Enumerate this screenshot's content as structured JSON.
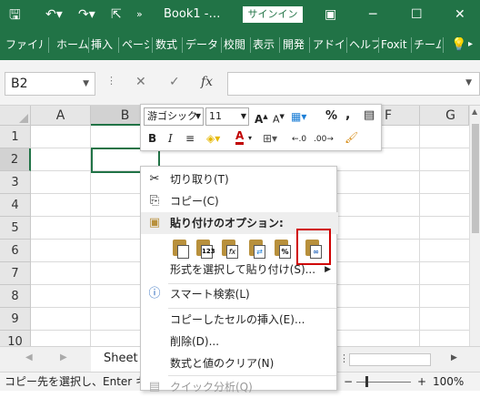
{
  "window": {
    "title": "Book1 -…",
    "signin": "サインイン"
  },
  "ribbon": {
    "tabs": [
      "ファイル",
      "ホーム",
      "挿入",
      "ページ",
      "数式",
      "データ",
      "校閲",
      "表示",
      "開発",
      "アドイ",
      "ヘルプ",
      "Foxit",
      "チーム"
    ]
  },
  "formula_bar": {
    "name_box": "B2",
    "fx": "fx"
  },
  "sheet": {
    "columns": [
      "A",
      "B",
      "C",
      "F",
      "G"
    ],
    "rows": [
      "1",
      "2",
      "3",
      "4",
      "5",
      "6",
      "7",
      "8",
      "9",
      "10"
    ]
  },
  "sheet_tab": "Sheet",
  "status": {
    "message": "コピー先を選択し、Enter キー",
    "zoom": "100%"
  },
  "mini_toolbar": {
    "font": "游ゴシック",
    "size": "11",
    "percent": "%",
    "comma": ","
  },
  "context_menu": {
    "cut": "切り取り(T)",
    "copy": "コピー(C)",
    "paste_header": "貼り付けのオプション:",
    "paste_special": "形式を選択して貼り付け(S)...",
    "smart_lookup": "スマート検索(L)",
    "insert_copied": "コピーしたセルの挿入(E)...",
    "delete": "削除(D)...",
    "clear": "数式と値のクリア(N)",
    "quick_analysis": "クイック分析(Q)",
    "paste_icons": [
      "paste-icon",
      "paste-values-icon",
      "paste-formulas-icon",
      "paste-transpose-icon",
      "paste-formatting-icon",
      "paste-link-icon"
    ],
    "paste_123": "123",
    "paste_fx": "fx",
    "paste_pct": "%"
  }
}
